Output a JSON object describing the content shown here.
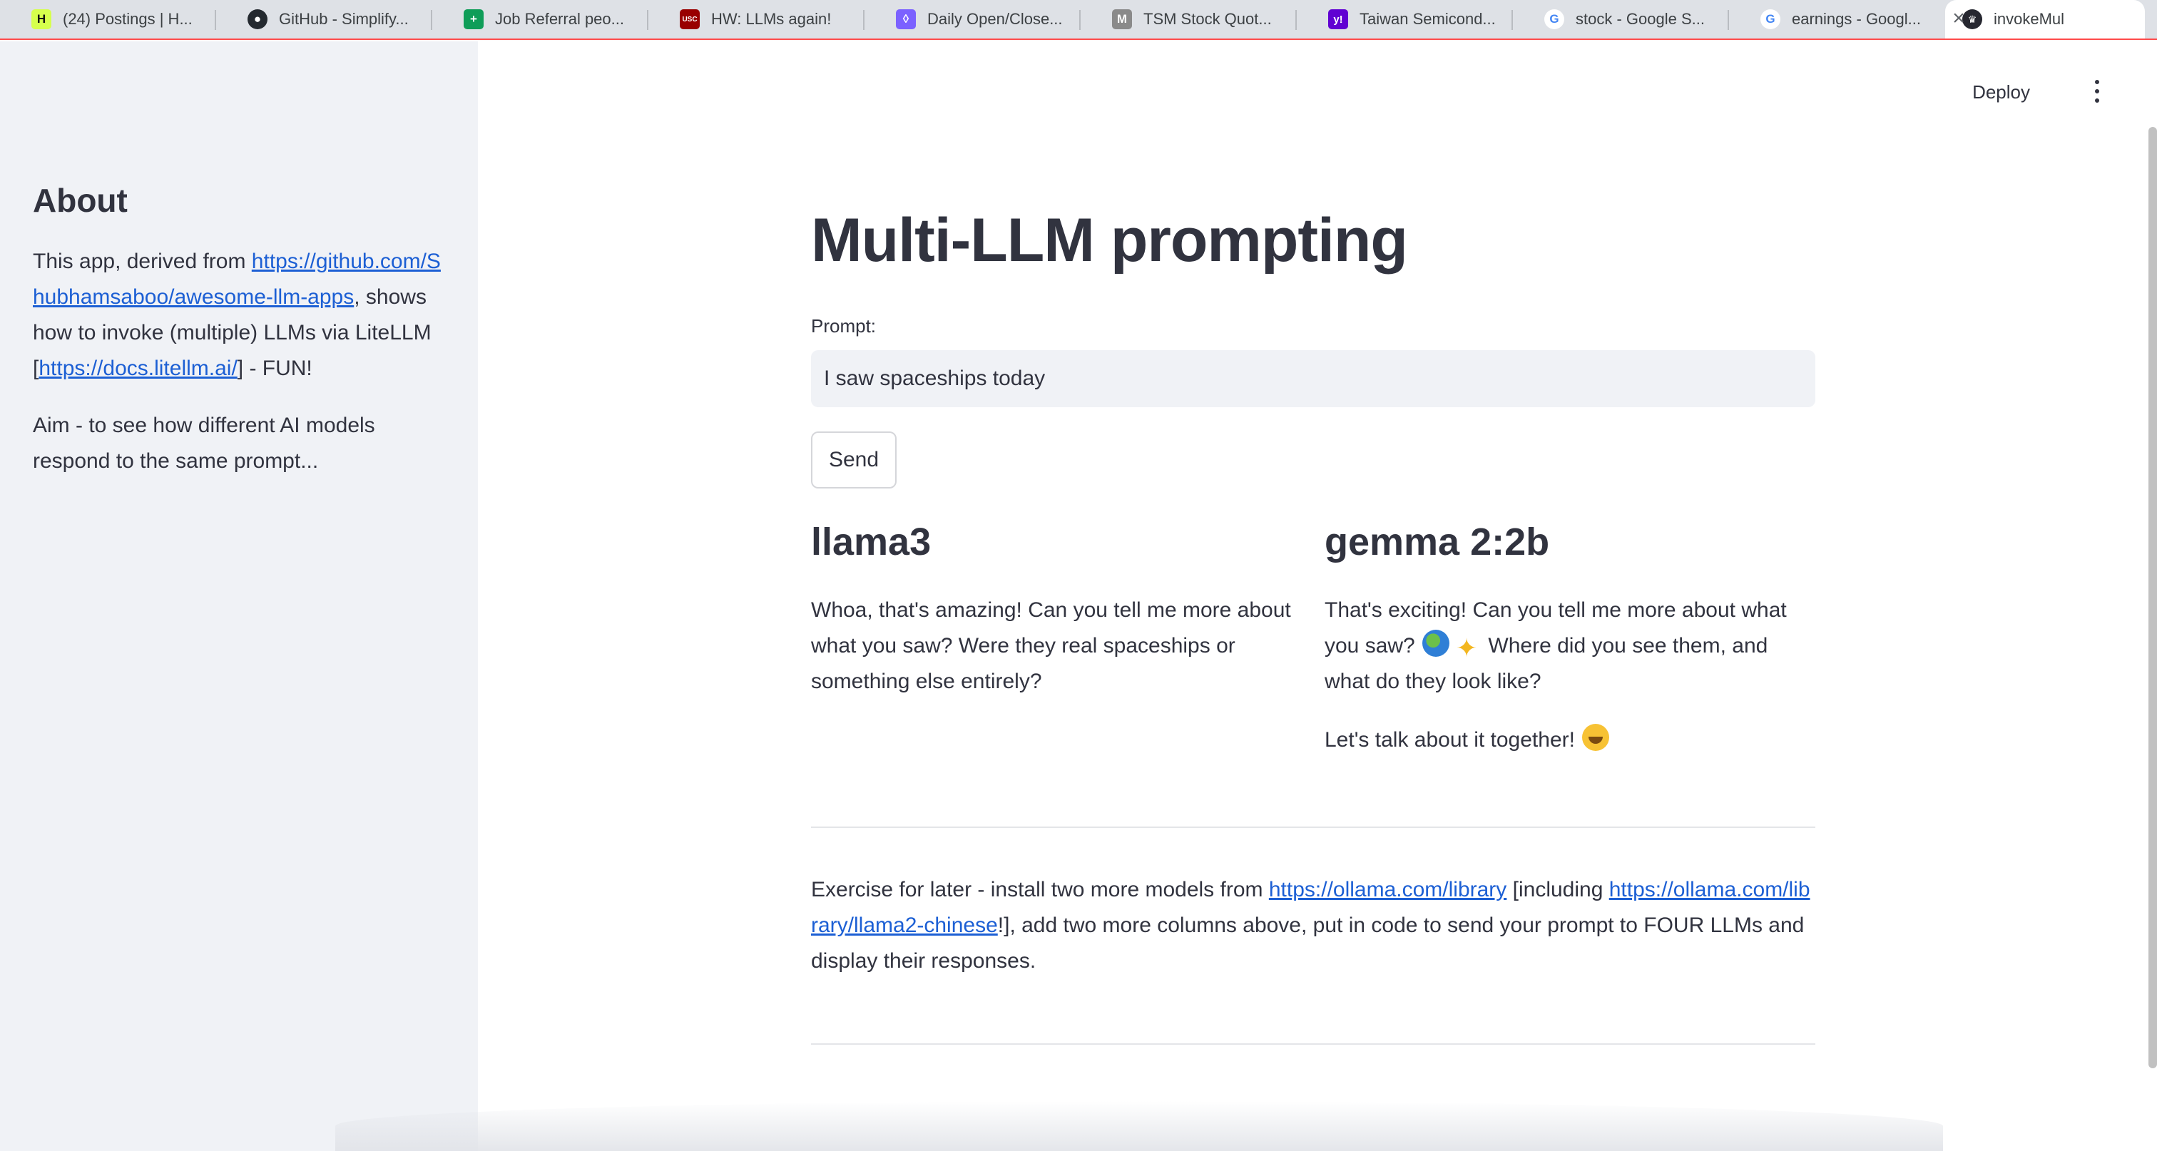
{
  "browser": {
    "tabs": [
      {
        "title": "(24) Postings | H...",
        "icon": "handshake-icon",
        "color": "#d6ff4d",
        "glyph": "H"
      },
      {
        "title": "GitHub - Simplify...",
        "icon": "github-icon",
        "color": "#24292f",
        "glyph": "●"
      },
      {
        "title": "Job Referral peo...",
        "icon": "sheets-icon",
        "color": "#0f9d58",
        "glyph": "+"
      },
      {
        "title": "HW: LLMs again!",
        "icon": "usc-icon",
        "color": "#990000",
        "glyph": "USC"
      },
      {
        "title": "Daily Open/Close...",
        "icon": "polygon-icon",
        "color": "#7b61ff",
        "glyph": "◊"
      },
      {
        "title": "TSM Stock Quot...",
        "icon": "m-icon",
        "color": "#8a8a8a",
        "glyph": "M"
      },
      {
        "title": "Taiwan Semicond...",
        "icon": "yahoo-icon",
        "color": "#6001d2",
        "glyph": "y!"
      },
      {
        "title": "stock - Google S...",
        "icon": "google-icon",
        "color": "#ffffff",
        "glyph": "G"
      },
      {
        "title": "earnings - Googl...",
        "icon": "google-icon",
        "color": "#ffffff",
        "glyph": "G"
      }
    ],
    "active_tab": {
      "title": "invokeMul",
      "icon": "streamlit-icon"
    },
    "close_glyph": "×"
  },
  "sidebar": {
    "heading": "About",
    "p1_prefix": "This app, derived from ",
    "p1_link1": "https://github.com/Shubhamsaboo/awesome-llm-apps",
    "p1_mid": ", shows how to invoke (multiple) LLMs via LiteLLM [",
    "p1_link2": "https://docs.litellm.ai/",
    "p1_suffix": "] - FUN!",
    "p2": "Aim - to see how different AI models respond to the same prompt..."
  },
  "header": {
    "deploy_label": "Deploy"
  },
  "main": {
    "title": "Multi-LLM prompting",
    "prompt_label": "Prompt:",
    "prompt_value": "I saw spaceships today",
    "send_label": "Send",
    "columns": [
      {
        "model": "llama3",
        "response": "Whoa, that's amazing! Can you tell me more about what you saw? Were they real spaceships or something else entirely?"
      },
      {
        "model": "gemma 2:2b",
        "response_a": "That's exciting! Can you tell me more about what you saw?",
        "response_b": " Where did you see them, and what do they look like?",
        "response_c": "Let's talk about it together!"
      }
    ],
    "exercise_prefix": "Exercise for later - install two more models from ",
    "exercise_link1": "https://ollama.com/library",
    "exercise_mid": " [including ",
    "exercise_link2": "https://ollama.com/library/llama2-chinese",
    "exercise_suffix": "!], add two more columns above, put in code to send your prompt to FOUR LLMs and display their responses."
  }
}
